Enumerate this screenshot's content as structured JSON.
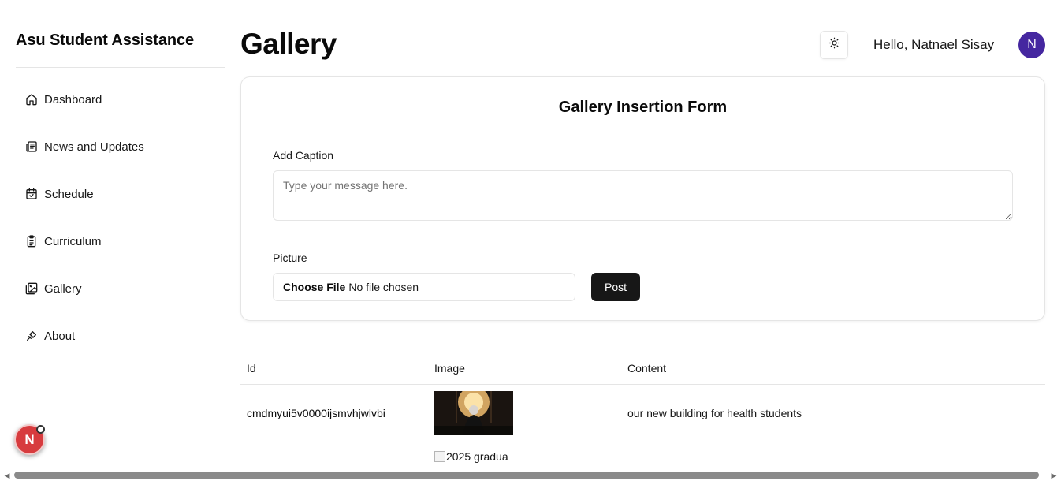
{
  "sidebar": {
    "brand": "Asu Student Assistance",
    "items": [
      {
        "label": "Dashboard",
        "icon": "home-icon"
      },
      {
        "label": "News and Updates",
        "icon": "newspaper-icon"
      },
      {
        "label": "Schedule",
        "icon": "calendar-icon"
      },
      {
        "label": "Curriculum",
        "icon": "clipboard-icon"
      },
      {
        "label": "Gallery",
        "icon": "images-icon"
      },
      {
        "label": "About",
        "icon": "info-icon"
      }
    ],
    "floating_avatar": "N"
  },
  "header": {
    "title": "Gallery",
    "greeting": "Hello, Natnael Sisay",
    "avatar_initial": "N",
    "theme_toggle_icon": "sun-icon"
  },
  "form": {
    "title": "Gallery Insertion Form",
    "caption_label": "Add Caption",
    "caption_placeholder": "Type your message here.",
    "caption_value": "",
    "picture_label": "Picture",
    "file_button": "Choose File",
    "file_status": "No file chosen",
    "submit": "Post"
  },
  "table": {
    "headers": {
      "id": "Id",
      "image": "Image",
      "content": "Content"
    },
    "rows": [
      {
        "id": "cmdmyui5v0000ijsmvhjwlvbi",
        "image": "dark-figure-photo",
        "content": "our new building for health students"
      },
      {
        "id": "",
        "image_alt": "2025 gradua",
        "content": ""
      }
    ]
  },
  "colors": {
    "primary": "#171717",
    "avatar": "#4527a0",
    "fab": "#d73b3e",
    "border": "#e5e5e5"
  }
}
